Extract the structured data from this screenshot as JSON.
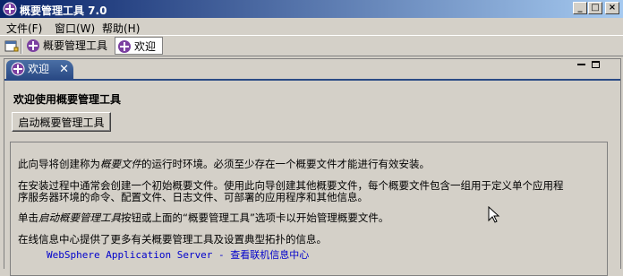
{
  "window": {
    "title": "概要管理工具 7.0",
    "controls": {
      "minimize": "_",
      "maximize": "□",
      "close": "×"
    }
  },
  "menu": [
    {
      "label": "文件(F)"
    },
    {
      "label": "窗口(W)"
    },
    {
      "label": "帮助(H)"
    }
  ],
  "toolbar": {
    "tabs": [
      {
        "label": "概要管理工具",
        "icon": "profile-tool-icon"
      },
      {
        "label": "欢迎",
        "icon": "welcome-icon"
      }
    ]
  },
  "editor": {
    "tab_label": "欢迎",
    "close_glyph": "✕",
    "heading": "欢迎使用概要管理工具",
    "launch_button": "启动概要管理工具",
    "paragraphs": {
      "p1_before": "此向导将创建称为",
      "p1_em": "概要文件",
      "p1_after": "的运行时环境。必须至少存在一个概要文件才能进行有效安装。",
      "p2_line1": "在安装过程中通常会创建一个初始概要文件。使用此向导创建其他概要文件，每个概要文件包含一组用于定义单个应用程",
      "p2_line2": "序服务器环境的命令、配置文件、日志文件、可部署的应用程序和其他信息。",
      "p3_before": "单击",
      "p3_em": "启动概要管理工具",
      "p3_after": "按钮或上面的“概要管理工具”选项卡以开始管理概要文件。",
      "p4": "在线信息中心提供了更多有关概要管理工具及设置典型拓扑的信息。"
    },
    "link": "WebSphere Application Server - 查看联机信息中心"
  },
  "colors": {
    "title_start": "#0a246a",
    "title_end": "#a6caf0",
    "tab_active": "#2a4a85",
    "link": "#0000cc"
  }
}
